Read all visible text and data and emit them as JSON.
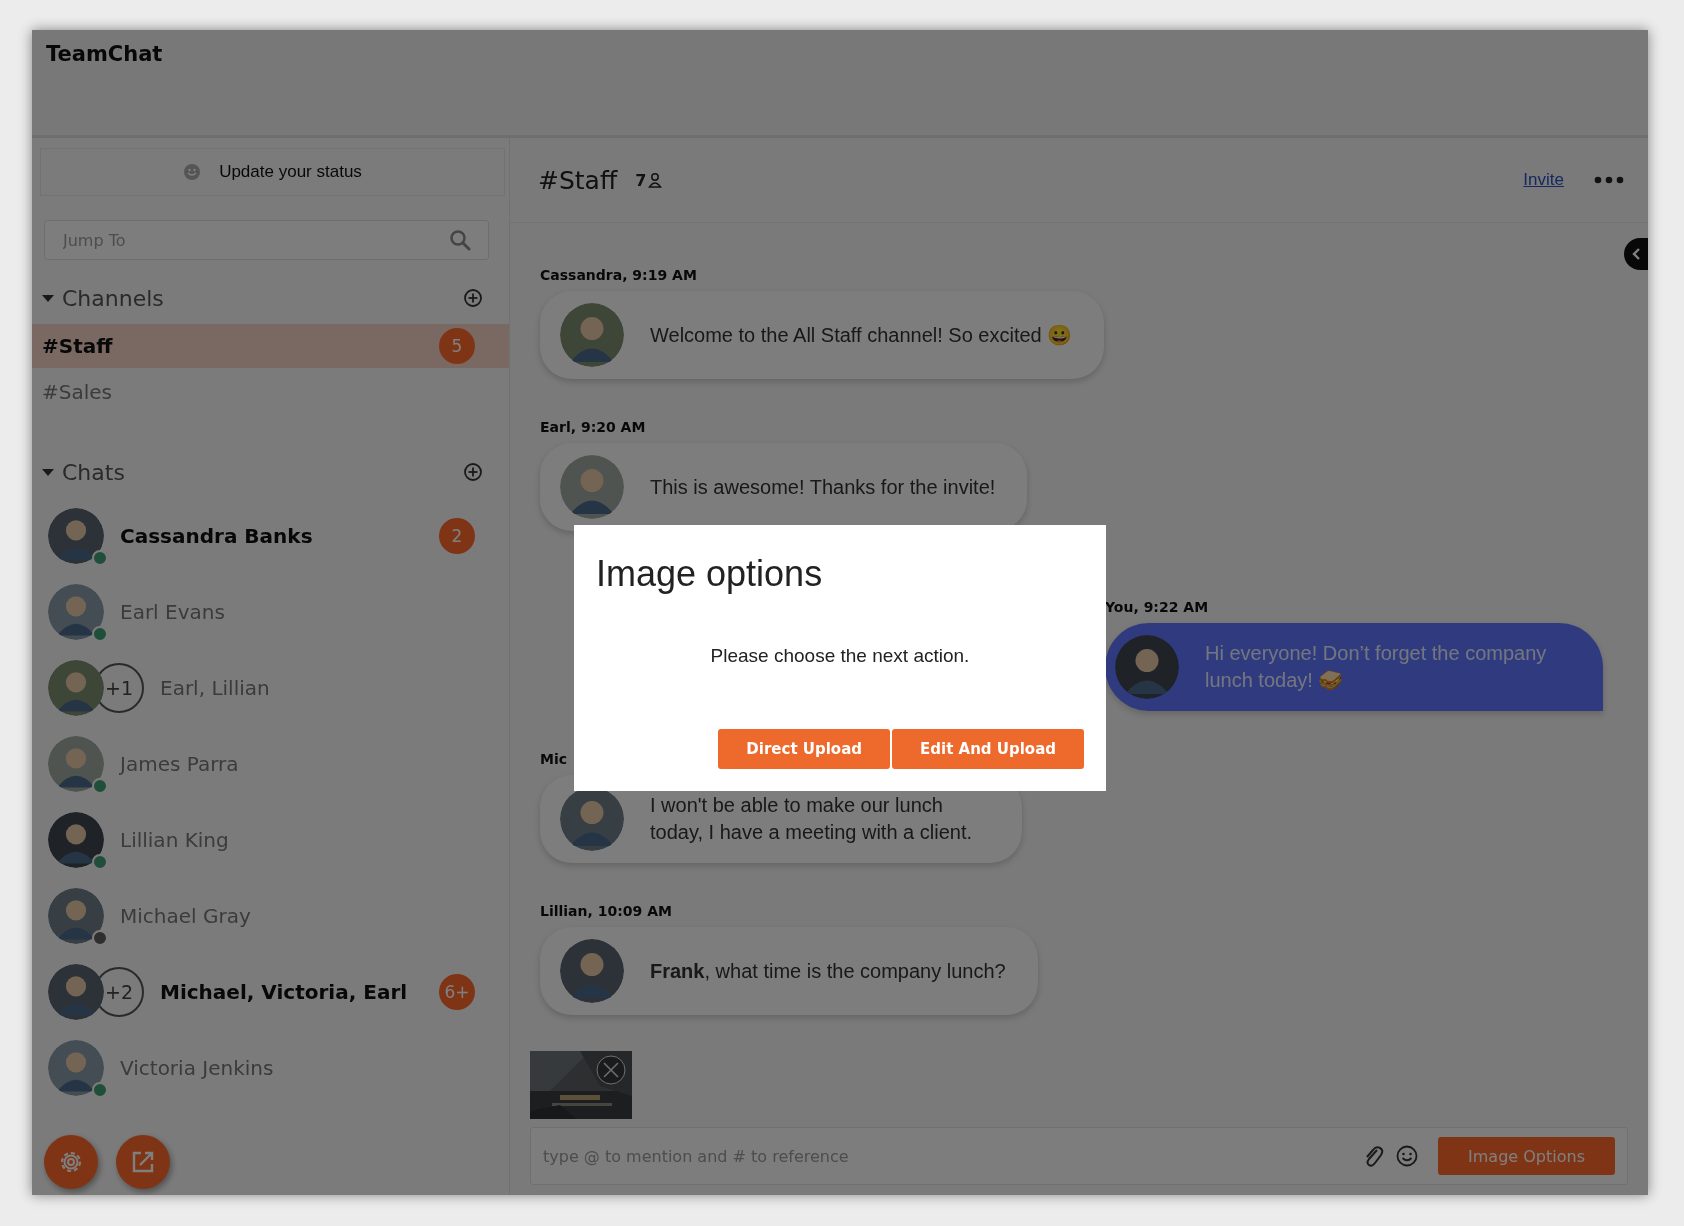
{
  "app": {
    "title": "TeamChat"
  },
  "sidebar": {
    "status_button": "Update your status",
    "search": {
      "placeholder": "Jump To"
    },
    "channels": {
      "title": "Channels",
      "expanded": true,
      "items": [
        {
          "name": "#Staff",
          "selected": true,
          "badge": "5"
        },
        {
          "name": "#Sales",
          "selected": false
        }
      ]
    },
    "chats": {
      "title": "Chats",
      "expanded": true,
      "items": [
        {
          "kind": "person",
          "name": "Cassandra Banks",
          "online": true,
          "unread": true,
          "badge": "2"
        },
        {
          "kind": "person",
          "name": "Earl Evans",
          "online": true,
          "unread": false
        },
        {
          "kind": "group",
          "name": "Earl, Lillian",
          "extra": "+1",
          "unread": false
        },
        {
          "kind": "person",
          "name": "James Parra",
          "online": true,
          "unread": false
        },
        {
          "kind": "person",
          "name": "Lillian King",
          "online": true,
          "unread": false
        },
        {
          "kind": "person",
          "name": "Michael Gray",
          "online": false,
          "unread": false
        },
        {
          "kind": "group",
          "name": "Michael, Victoria, Earl",
          "extra": "+2",
          "unread": true,
          "badge": "6+"
        },
        {
          "kind": "person",
          "name": "Victoria Jenkins",
          "online": true,
          "unread": false
        }
      ]
    }
  },
  "channel": {
    "name": "#Staff",
    "members": "7",
    "invite": "Invite"
  },
  "messages": [
    {
      "kind": "incoming",
      "author": "Cassandra, 9:19 AM",
      "text": "Welcome to the All Staff channel! So excited 😀"
    },
    {
      "kind": "incoming",
      "author": "Earl, 9:20 AM",
      "text": "This is awesome! Thanks for the invite!"
    },
    {
      "kind": "own",
      "author": "You, 9:22 AM",
      "text": "Hi everyone! Don’t forget the company lunch today! 🥪"
    },
    {
      "kind": "incoming",
      "author": "Mic",
      "text": "I won't be able to make our lunch today, I have a meeting with a client."
    },
    {
      "kind": "incoming",
      "author": "Lillian, 10:09 AM",
      "text": "**Frank**, what time is the company lunch?"
    }
  ],
  "composer": {
    "placeholder": "type @ to mention and # to reference",
    "button": "Image Options"
  },
  "dialog": {
    "title": "Image options",
    "message": "Please choose the next action.",
    "buttons": [
      "Direct Upload",
      "Edit And Upload"
    ]
  }
}
